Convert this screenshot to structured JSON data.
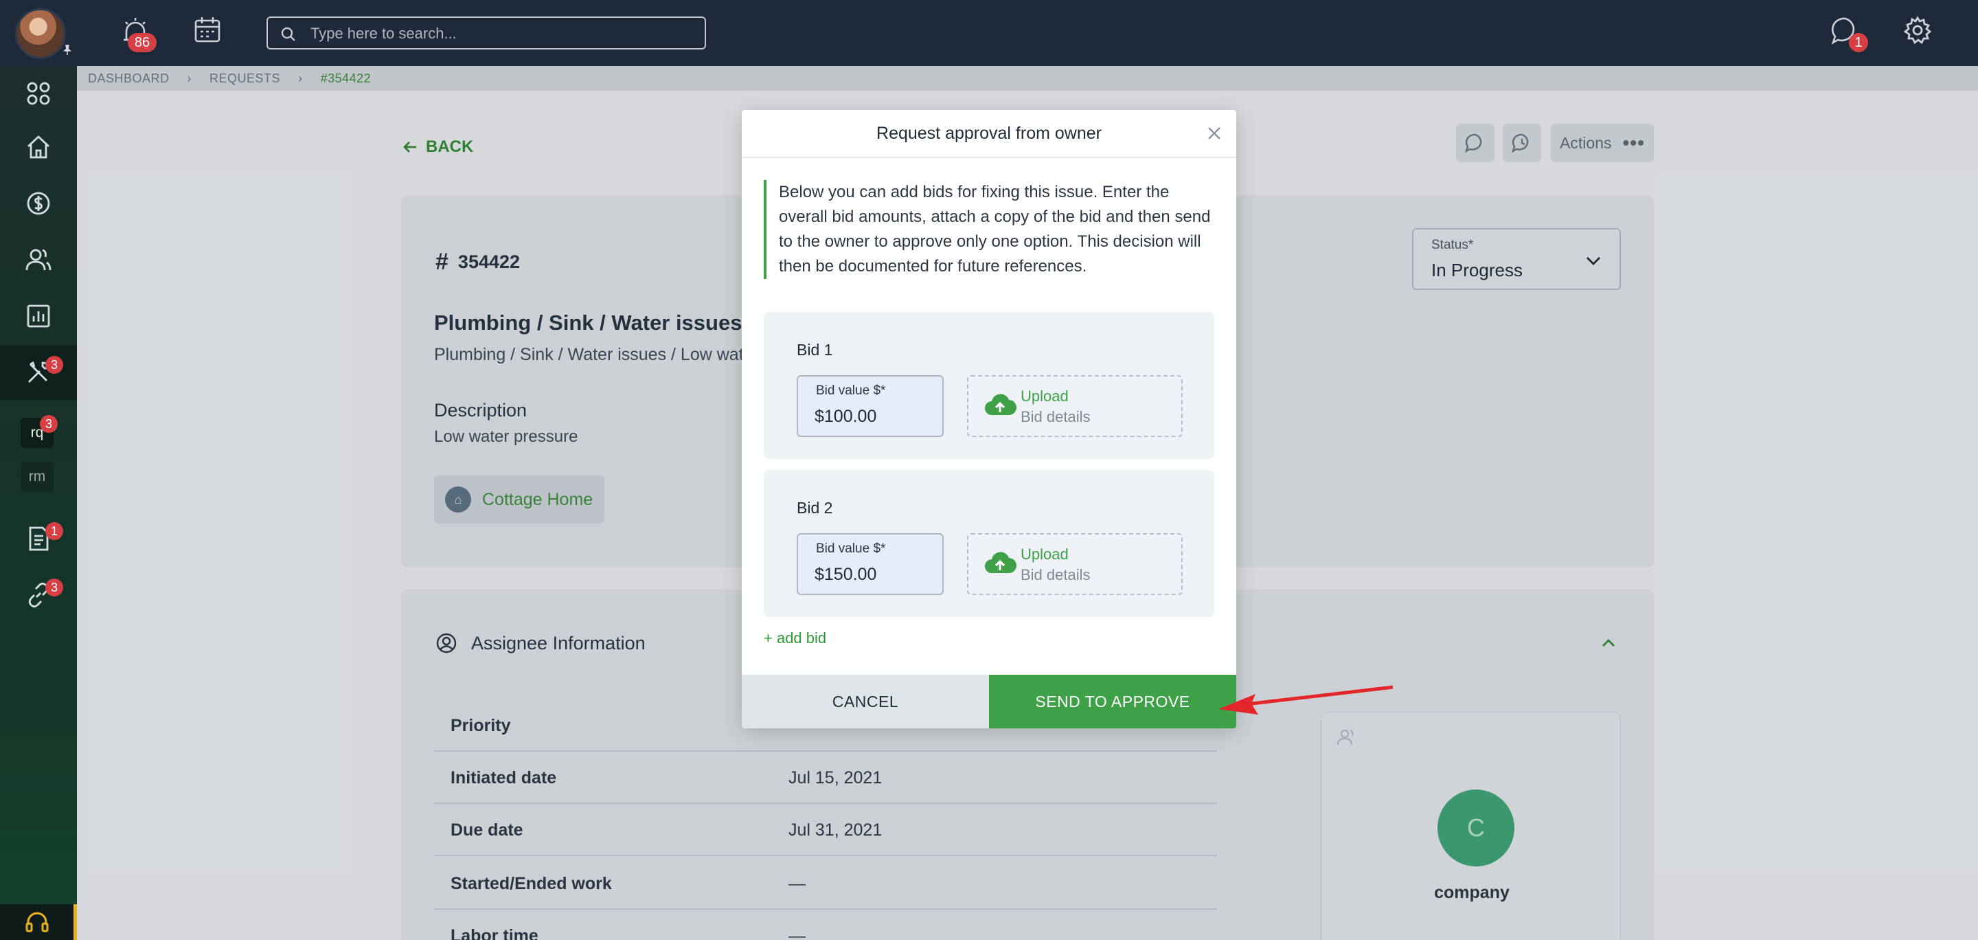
{
  "topbar": {
    "search_placeholder": "Type here to search...",
    "alarm_badge": "86",
    "chat_badge": "1"
  },
  "sidebar": {
    "tools_badge": "3",
    "rq_label": "rq",
    "rq_badge": "3",
    "rm_label": "rm",
    "docs_badge": "1",
    "links_badge": "3"
  },
  "breadcrumb": {
    "items": [
      "DASHBOARD",
      "REQUESTS",
      "#354422"
    ]
  },
  "page": {
    "back_label": "BACK",
    "actions_label": "Actions",
    "request_id": "354422",
    "title": "Plumbing / Sink / Water issues /",
    "subtitle": "Plumbing / Sink / Water issues / Low wate",
    "description_heading": "Description",
    "description_text": "Low water pressure",
    "property_label": "Cottage Home",
    "status_label": "Status*",
    "status_value": "In Progress",
    "assignee_heading": "Assignee Information",
    "details": [
      {
        "key": "Priority",
        "value": ""
      },
      {
        "key": "Initiated date",
        "value": "Jul 15, 2021"
      },
      {
        "key": "Due date",
        "value": "Jul 31, 2021"
      },
      {
        "key": "Started/Ended work",
        "value": "—"
      },
      {
        "key": "Labor time",
        "value": "—"
      }
    ],
    "company_initial": "C",
    "company_name": "company"
  },
  "modal": {
    "title": "Request approval from owner",
    "info": "Below you can add bids for fixing this issue. Enter the overall bid amounts, attach a copy of the bid and then send to the owner to approve only one option. This decision will then be documented for future references.",
    "bids": [
      {
        "title": "Bid 1",
        "field_label": "Bid value $*",
        "value": "$100.00",
        "upload_label": "Upload",
        "upload_sub": "Bid details"
      },
      {
        "title": "Bid 2",
        "field_label": "Bid value $*",
        "value": "$150.00",
        "upload_label": "Upload",
        "upload_sub": "Bid details"
      }
    ],
    "add_bid_label": "+ add bid",
    "cancel_label": "CANCEL",
    "send_label": "SEND TO APPROVE"
  },
  "colors": {
    "topbar": "#1e2a3a",
    "accent_green": "#3ea147",
    "badge_red": "#d64045",
    "annotation_arrow": "#e3262b"
  }
}
